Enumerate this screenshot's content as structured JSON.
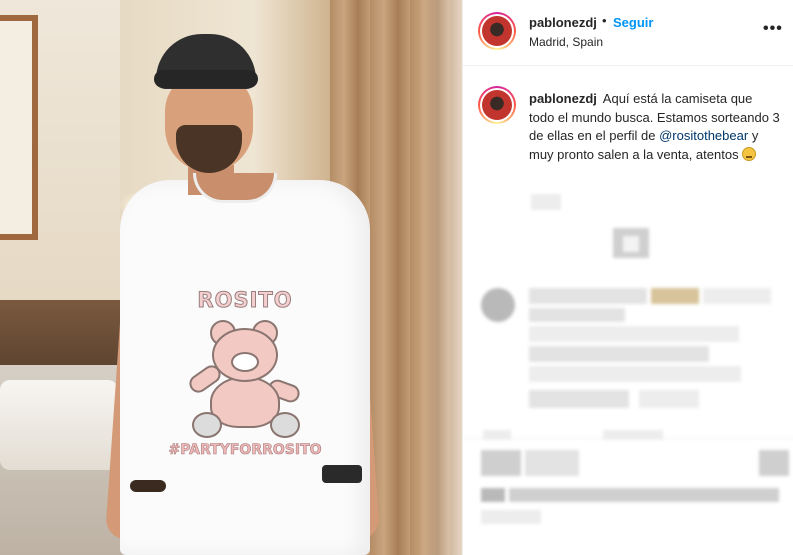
{
  "post": {
    "username": "pablonezdj",
    "separator": "•",
    "follow_label": "Seguir",
    "location": "Madrid, Spain",
    "more_label": "•••"
  },
  "caption": {
    "username": "pablonezdj",
    "text_before_mention": "Aquí está la camiseta que todo el mundo busca. Estamos sorteando 3 de ellas en el perfil de",
    "mention": "@rositothebear",
    "text_after_mention": "y muy pronto salen a la venta, atentos"
  },
  "photo": {
    "shirt_top_text": "ROSITO",
    "shirt_bottom_text": "#PARTYFORROSITO"
  },
  "icons": {
    "more": "more-options-icon",
    "avatar": "profile-avatar",
    "emoji": "grimacing-face-emoji"
  },
  "colors": {
    "follow": "#0095f6",
    "mention": "#00376b",
    "text": "#262626"
  }
}
